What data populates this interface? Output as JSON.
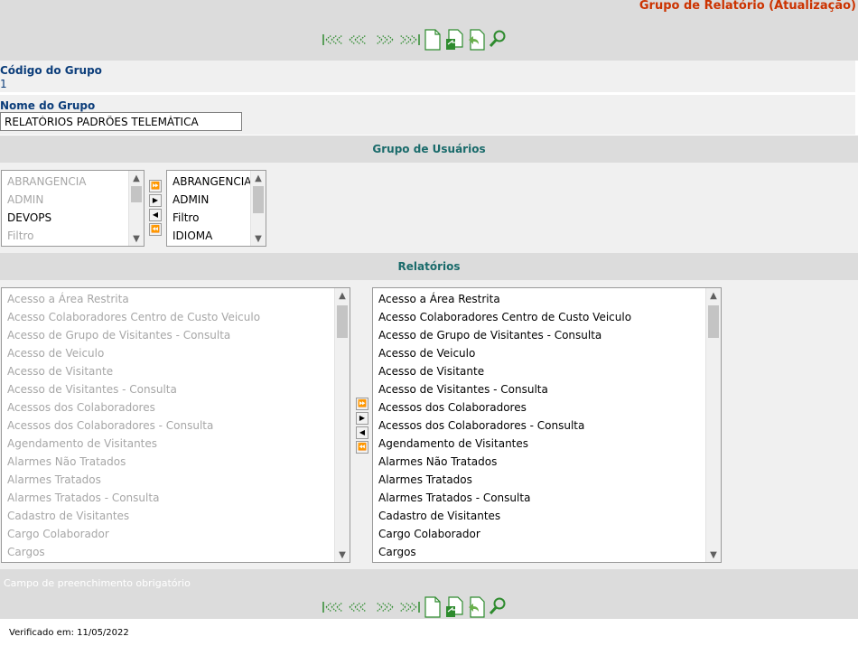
{
  "header": {
    "title": "Grupo de Relatório (Atualização)"
  },
  "toolbar_icons": [
    {
      "name": "first-record-icon"
    },
    {
      "name": "previous-record-icon"
    },
    {
      "name": "next-record-icon"
    },
    {
      "name": "last-record-icon"
    },
    {
      "name": "new-document-icon"
    },
    {
      "name": "save-document-icon"
    },
    {
      "name": "undo-document-icon"
    },
    {
      "name": "search-icon"
    }
  ],
  "fields": {
    "codigo_label": "Código do Grupo",
    "codigo_value": "1",
    "nome_label": "Nome do Grupo",
    "nome_value": "RELATÓRIOS PADRÕES TELEMÁTICA"
  },
  "usuarios": {
    "title": "Grupo de Usuários",
    "available": [
      "ABRANGENCIA",
      "ADMIN",
      "DEVOPS",
      "Filtro"
    ],
    "available_enabled": [
      false,
      false,
      true,
      false
    ],
    "selected": [
      "ABRANGENCIA",
      "ADMIN",
      "Filtro",
      "IDIOMA"
    ]
  },
  "relatorios": {
    "title": "Relatórios",
    "available": [
      "Acesso a Área Restrita",
      "Acesso Colaboradores Centro de Custo Veiculo",
      "Acesso de Grupo de Visitantes - Consulta",
      "Acesso de Veiculo",
      "Acesso de Visitante",
      "Acesso de Visitantes - Consulta",
      "Acessos dos Colaboradores",
      "Acessos dos Colaboradores - Consulta",
      "Agendamento de Visitantes",
      "Alarmes Não Tratados",
      "Alarmes Tratados",
      "Alarmes Tratados - Consulta",
      "Cadastro de Visitantes",
      "Cargo Colaborador",
      "Cargos"
    ],
    "selected": [
      "Acesso a Área Restrita",
      "Acesso Colaboradores Centro de Custo Veiculo",
      "Acesso de Grupo de Visitantes - Consulta",
      "Acesso de Veiculo",
      "Acesso de Visitante",
      "Acesso de Visitantes - Consulta",
      "Acessos dos Colaboradores",
      "Acessos dos Colaboradores - Consulta",
      "Agendamento de Visitantes",
      "Alarmes Não Tratados",
      "Alarmes Tratados",
      "Alarmes Tratados - Consulta",
      "Cadastro de Visitantes",
      "Cargo Colaborador",
      "Cargos"
    ]
  },
  "transfer_buttons": {
    "all_right": "⏩",
    "right": "▶",
    "left": "◀",
    "all_left": "⏪"
  },
  "footer": {
    "required_note": "Campo de preenchimento obrigatório",
    "verified": "Verificado em: 11/05/2022"
  },
  "colors": {
    "header_title": "#cc3300",
    "label_blue": "#0b3d7a",
    "section_teal": "#1a6b6b",
    "band_gray": "#dcdcdc",
    "pane_gray": "#f0f0f0",
    "icon_green": "#2e8b2e"
  }
}
